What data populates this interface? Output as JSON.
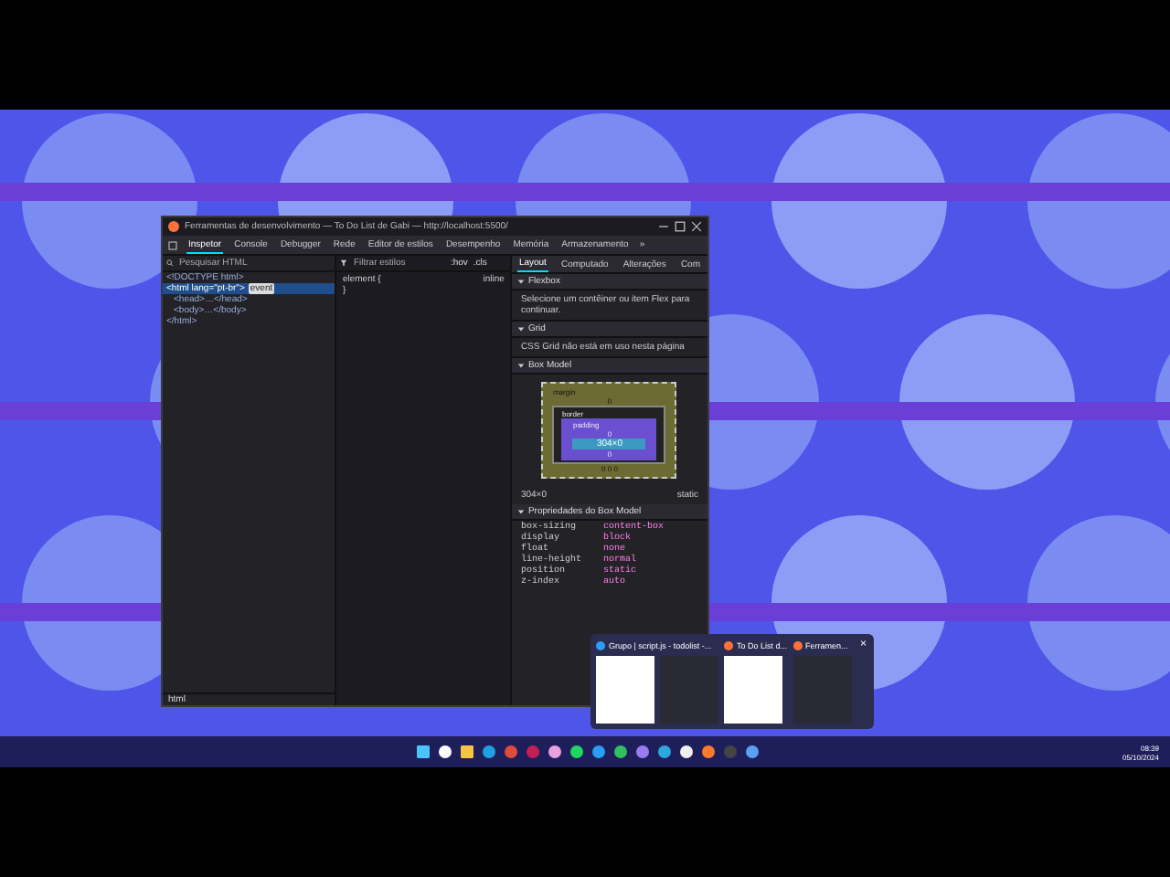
{
  "window": {
    "title": "Ferramentas de desenvolvimento — To Do List de Gabi — http://localhost:5500/"
  },
  "toolbar_tabs": [
    {
      "label": "Inspetor",
      "selected": true
    },
    {
      "label": "Console",
      "selected": false
    },
    {
      "label": "Debugger",
      "selected": false
    },
    {
      "label": "Rede",
      "selected": false
    },
    {
      "label": "Editor de estilos",
      "selected": false
    },
    {
      "label": "Desempenho",
      "selected": false
    },
    {
      "label": "Memória",
      "selected": false
    },
    {
      "label": "Armazenamento",
      "selected": false
    }
  ],
  "toolbar_overflow": "»",
  "inspector": {
    "search": {
      "placeholder": "Pesquisar HTML"
    },
    "tree": [
      {
        "text": "<!DOCTYPE html>",
        "selected": false
      },
      {
        "text": "<html lang=\"pt-br\">",
        "selected": true,
        "badge": "event",
        "children": [
          {
            "text": "<head>…</head>",
            "selected": false
          },
          {
            "text": "<body>…</body>",
            "selected": false
          }
        ]
      },
      {
        "text": "</html>",
        "selected": false
      }
    ],
    "breadcrumb": "html"
  },
  "rules": {
    "filter": {
      "placeholder": "Filtrar estilos"
    },
    "buttons": [
      ":hov",
      ".cls"
    ],
    "lines": [
      "element {",
      "}"
    ],
    "source": "inline"
  },
  "side_tabs": [
    {
      "label": "Layout",
      "selected": true
    },
    {
      "label": "Computado",
      "selected": false
    },
    {
      "label": "Alterações",
      "selected": false
    },
    {
      "label": "Com",
      "selected": false
    }
  ],
  "sections": [
    {
      "title": "Flexbox",
      "expanded": true,
      "text": "Selecione um contêiner ou item Flex para continuar."
    },
    {
      "title": "Grid",
      "expanded": true,
      "text": "CSS Grid não está em uso nesta página"
    },
    {
      "title": "Box Model",
      "expanded": true
    }
  ],
  "box_model": {
    "margin": "margin",
    "border": "border",
    "padding": "padding",
    "content": "304×0",
    "values": [
      "0",
      "0",
      "0",
      "0",
      "0",
      "0"
    ],
    "size": "304×0",
    "position": "static"
  },
  "box_properties": {
    "title": "Propriedades do Box Model",
    "rows": [
      {
        "name": "box-sizing",
        "value": "content-box"
      },
      {
        "name": "display",
        "value": "block"
      },
      {
        "name": "float",
        "value": "none"
      },
      {
        "name": "line-height",
        "value": "normal"
      },
      {
        "name": "position",
        "value": "static"
      },
      {
        "name": "z-index",
        "value": "auto"
      }
    ]
  },
  "taskbar_preview": {
    "items": [
      {
        "title": "Grupo | script.js - todolist -..."
      },
      {
        "title": "To Do List d..."
      },
      {
        "title": "Ferramen..."
      }
    ],
    "close": "×"
  },
  "clock": {
    "time": "08:39",
    "date": "05/10/2024"
  }
}
